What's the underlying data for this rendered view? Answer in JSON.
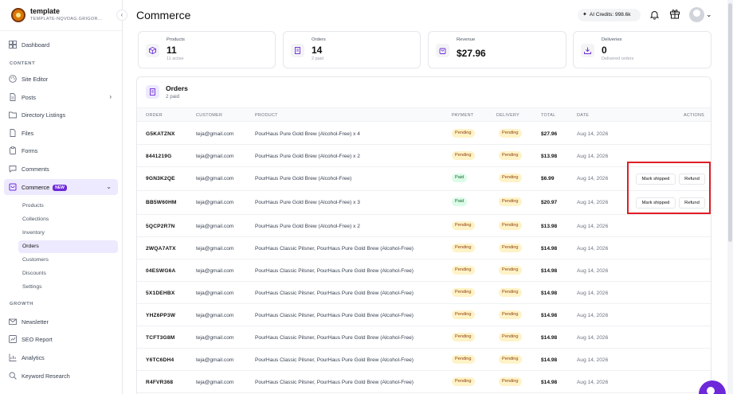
{
  "brand": {
    "name": "template",
    "subtitle": "TEMPLATE-NQVDAG.GRIGOR..."
  },
  "sidebar": {
    "items": [
      {
        "label": "Dashboard",
        "icon": "dashboard-icon"
      },
      {
        "label": "Site Editor",
        "icon": "palette-icon"
      },
      {
        "label": "Posts",
        "icon": "document-icon"
      },
      {
        "label": "Directory Listings",
        "icon": "folder-icon"
      },
      {
        "label": "Files",
        "icon": "file-icon"
      },
      {
        "label": "Forms",
        "icon": "clipboard-icon"
      },
      {
        "label": "Comments",
        "icon": "comment-icon"
      },
      {
        "label": "Commerce",
        "icon": "cart-icon",
        "badge": "NEW"
      }
    ],
    "section_content": "CONTENT",
    "section_growth": "GROWTH",
    "commerce_sub": [
      "Products",
      "Collections",
      "Inventory",
      "Orders",
      "Customers",
      "Discounts",
      "Settings"
    ],
    "growth_items": [
      {
        "label": "Newsletter",
        "icon": "mail-icon"
      },
      {
        "label": "SEO Report",
        "icon": "seo-icon"
      },
      {
        "label": "Analytics",
        "icon": "chart-icon"
      },
      {
        "label": "Keyword Research",
        "icon": "search-icon"
      }
    ]
  },
  "header": {
    "title": "Commerce",
    "credits": "AI Credits: 998.6k"
  },
  "stats": [
    {
      "title": "Products",
      "value": "11",
      "sub": "11 active",
      "icon": "box-icon"
    },
    {
      "title": "Orders",
      "value": "14",
      "sub": "2 paid",
      "icon": "receipt-icon"
    },
    {
      "title": "Revenue",
      "value": "$27.96",
      "sub": "",
      "icon": "bag-icon"
    },
    {
      "title": "Deliveries",
      "value": "0",
      "sub": "Delivered orders",
      "icon": "download-icon"
    }
  ],
  "orders": {
    "title": "Orders",
    "subtitle": "2 paid",
    "columns": [
      "ORDER",
      "CUSTOMER",
      "PRODUCT",
      "PAYMENT",
      "DELIVERY",
      "TOTAL",
      "DATE",
      "ACTIONS"
    ],
    "actions": {
      "ship": "Mark shipped",
      "refund": "Refund"
    },
    "rows": [
      {
        "order": "G5KATZNX",
        "customer": "teja@gmail.com",
        "product": "PourHaus Pure Gold Brew (Alcohol-Free) x 4",
        "payment": "Pending",
        "delivery": "Pending",
        "total": "$27.96",
        "date": "Aug 14, 2026"
      },
      {
        "order": "8441219G",
        "customer": "teja@gmail.com",
        "product": "PourHaus Pure Gold Brew (Alcohol-Free) x 2",
        "payment": "Pending",
        "delivery": "Pending",
        "total": "$13.98",
        "date": "Aug 14, 2026"
      },
      {
        "order": "9GN3K2QE",
        "customer": "teja@gmail.com",
        "product": "PourHaus Pure Gold Brew (Alcohol-Free)",
        "payment": "Paid",
        "delivery": "Pending",
        "total": "$6.99",
        "date": "Aug 14, 2026"
      },
      {
        "order": "BB5W60HM",
        "customer": "teja@gmail.com",
        "product": "PourHaus Pure Gold Brew (Alcohol-Free) x 3",
        "payment": "Paid",
        "delivery": "Pending",
        "total": "$20.97",
        "date": "Aug 14, 2026"
      },
      {
        "order": "5QCP2R7N",
        "customer": "teja@gmail.com",
        "product": "PourHaus Pure Gold Brew (Alcohol-Free) x 2",
        "payment": "Pending",
        "delivery": "Pending",
        "total": "$13.98",
        "date": "Aug 14, 2026"
      },
      {
        "order": "2WQA7ATX",
        "customer": "teja@gmail.com",
        "product": "PourHaus Classic Pilsner, PourHaus Pure Gold Brew (Alcohol-Free)",
        "payment": "Pending",
        "delivery": "Pending",
        "total": "$14.98",
        "date": "Aug 14, 2026"
      },
      {
        "order": "04ESWG6A",
        "customer": "teja@gmail.com",
        "product": "PourHaus Classic Pilsner, PourHaus Pure Gold Brew (Alcohol-Free)",
        "payment": "Pending",
        "delivery": "Pending",
        "total": "$14.98",
        "date": "Aug 14, 2026"
      },
      {
        "order": "5X1DEHBX",
        "customer": "teja@gmail.com",
        "product": "PourHaus Classic Pilsner, PourHaus Pure Gold Brew (Alcohol-Free)",
        "payment": "Pending",
        "delivery": "Pending",
        "total": "$14.98",
        "date": "Aug 14, 2026"
      },
      {
        "order": "YHZ6PP3W",
        "customer": "teja@gmail.com",
        "product": "PourHaus Classic Pilsner, PourHaus Pure Gold Brew (Alcohol-Free)",
        "payment": "Pending",
        "delivery": "Pending",
        "total": "$14.98",
        "date": "Aug 14, 2026"
      },
      {
        "order": "TCFT3G8M",
        "customer": "teja@gmail.com",
        "product": "PourHaus Classic Pilsner, PourHaus Pure Gold Brew (Alcohol-Free)",
        "payment": "Pending",
        "delivery": "Pending",
        "total": "$14.98",
        "date": "Aug 14, 2026"
      },
      {
        "order": "Y6TC6DH4",
        "customer": "teja@gmail.com",
        "product": "PourHaus Classic Pilsner, PourHaus Pure Gold Brew (Alcohol-Free)",
        "payment": "Pending",
        "delivery": "Pending",
        "total": "$14.98",
        "date": "Aug 14, 2026"
      },
      {
        "order": "R4FVR368",
        "customer": "teja@gmail.com",
        "product": "PourHaus Classic Pilsner, PourHaus Pure Gold Brew (Alcohol-Free)",
        "payment": "Pending",
        "delivery": "Pending",
        "total": "$14.98",
        "date": "Aug 14, 2026"
      }
    ]
  },
  "colors": {
    "accent": "#6d28d9",
    "highlight": "#e11d25",
    "pending_bg": "#fef3c7",
    "paid_bg": "#dcfce7"
  }
}
